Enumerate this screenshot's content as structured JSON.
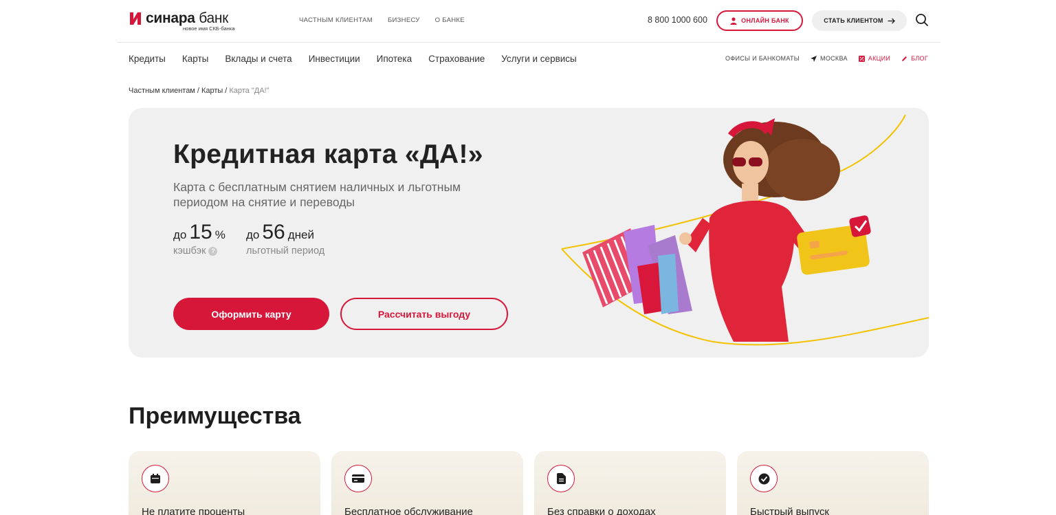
{
  "header": {
    "logo_name": "синара",
    "logo_name_suffix": " банк",
    "logo_sub": "новое имя СКБ-банка",
    "topnav": [
      "ЧАСТНЫМ КЛИЕНТАМ",
      "БИЗНЕСУ",
      "О БАНКЕ"
    ],
    "phone": "8 800 1000 600",
    "online_bank": "ОНЛАЙН БАНК",
    "become_client": "СТАТЬ КЛИЕНТОМ",
    "accent": "#d6173a"
  },
  "mainnav": [
    "Кредиты",
    "Карты",
    "Вклады и счета",
    "Инвестиции",
    "Ипотека",
    "Страхование",
    "Услуги и сервисы"
  ],
  "subnav": {
    "offices": "ОФИСЫ И БАНКОМАТЫ",
    "city": "МОСКВА",
    "promo": "АКЦИИ",
    "blog": "БЛОГ"
  },
  "breadcrumb": {
    "items": [
      "Частным клиентам",
      "Карты"
    ],
    "current": "Карта \"ДА!\"",
    "sep": "/"
  },
  "hero": {
    "title": "Кредитная карта «ДА!»",
    "lead": "Карта с бесплатным снятием наличных и льготным периодом на снятие и переводы",
    "stats": [
      {
        "pre": "до",
        "num": "15",
        "unit": "%",
        "caption": "кэшбэк",
        "help": "?"
      },
      {
        "pre": "до",
        "num": "56",
        "unit": "дней",
        "caption": "льготный период"
      }
    ],
    "primary_btn": "Оформить карту",
    "secondary_btn": "Рассчитать выгоду"
  },
  "advantages": {
    "title": "Преимущества",
    "items": [
      {
        "icon": "calendar-icon",
        "text": "Не платите проценты"
      },
      {
        "icon": "card-icon",
        "text": "Бесплатное обслуживание"
      },
      {
        "icon": "document-icon",
        "text": "Без справки о доходах"
      },
      {
        "icon": "check-icon",
        "text": "Быстрый выпуск"
      }
    ]
  }
}
